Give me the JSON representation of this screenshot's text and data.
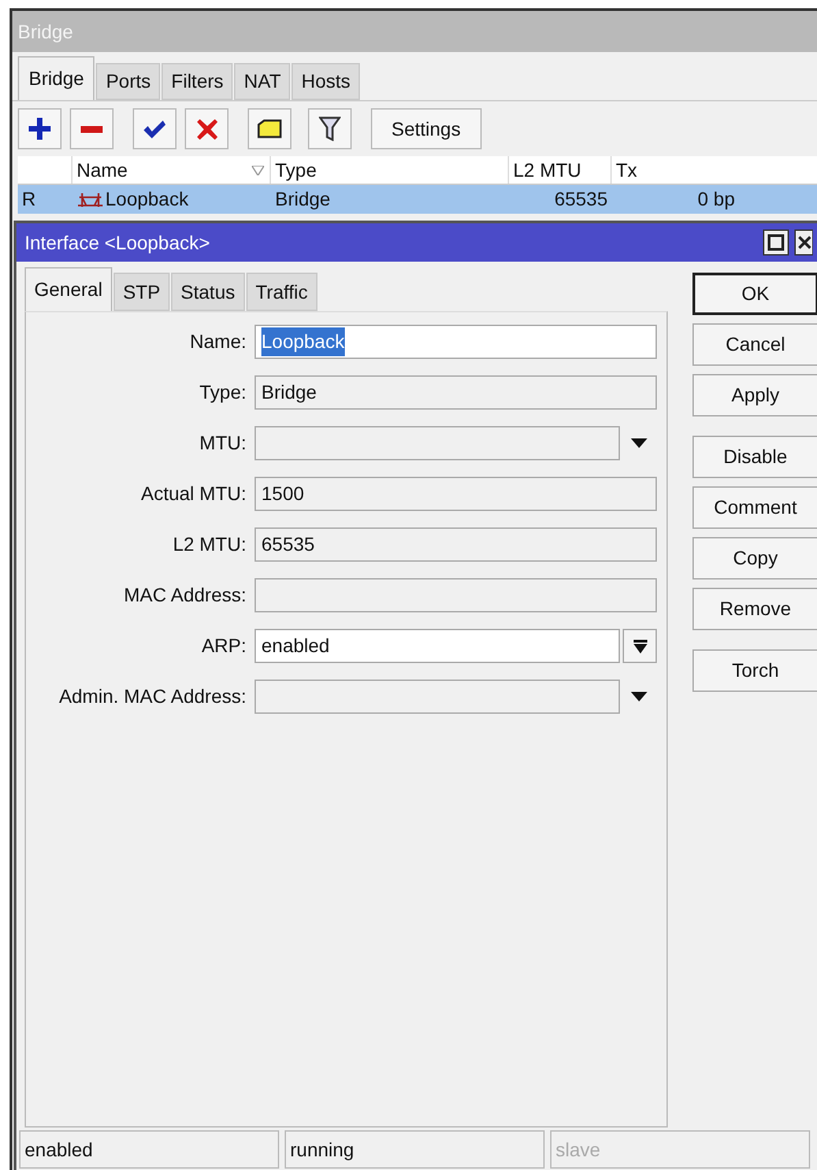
{
  "window": {
    "title": "Bridge"
  },
  "tabs": [
    {
      "label": "Bridge",
      "selected": true
    },
    {
      "label": "Ports",
      "selected": false
    },
    {
      "label": "Filters",
      "selected": false
    },
    {
      "label": "NAT",
      "selected": false
    },
    {
      "label": "Hosts",
      "selected": false
    }
  ],
  "toolbar": {
    "settings_label": "Settings"
  },
  "table": {
    "columns": [
      "",
      "Name",
      "Type",
      "L2 MTU",
      "Tx"
    ],
    "rows": [
      {
        "flag": "R",
        "name": "Loopback",
        "type": "Bridge",
        "l2mtu": "65535",
        "tx": "0 bp",
        "selected": true
      }
    ]
  },
  "dialog": {
    "title": "Interface <Loopback>",
    "tabs": [
      {
        "label": "General",
        "selected": true
      },
      {
        "label": "STP",
        "selected": false
      },
      {
        "label": "Status",
        "selected": false
      },
      {
        "label": "Traffic",
        "selected": false
      }
    ],
    "fields": [
      {
        "label": "Name:",
        "kind": "input",
        "value": "Loopback",
        "value_selected": true
      },
      {
        "label": "Type:",
        "kind": "readonly",
        "value": "Bridge"
      },
      {
        "label": "MTU:",
        "kind": "dropdown"
      },
      {
        "label": "Actual MTU:",
        "kind": "readonly",
        "value": "1500"
      },
      {
        "label": "L2 MTU:",
        "kind": "readonly",
        "value": "65535"
      },
      {
        "label": "MAC Address:",
        "kind": "readonly"
      },
      {
        "label": "ARP:",
        "kind": "select",
        "value": "enabled"
      },
      {
        "label": "Admin. MAC Address:",
        "kind": "dropdown"
      }
    ],
    "button_groups": [
      [
        {
          "label": "OK",
          "default": true
        },
        {
          "label": "Cancel",
          "default": false
        },
        {
          "label": "Apply",
          "default": false
        }
      ],
      [
        {
          "label": "Disable",
          "default": false
        },
        {
          "label": "Comment",
          "default": false
        },
        {
          "label": "Copy",
          "default": false
        },
        {
          "label": "Remove",
          "default": false
        }
      ],
      [
        {
          "label": "Torch",
          "default": false
        }
      ]
    ],
    "status_bar": [
      {
        "text": "enabled",
        "disabled": false
      },
      {
        "text": "running",
        "disabled": false
      },
      {
        "text": "slave",
        "disabled": true
      }
    ]
  }
}
